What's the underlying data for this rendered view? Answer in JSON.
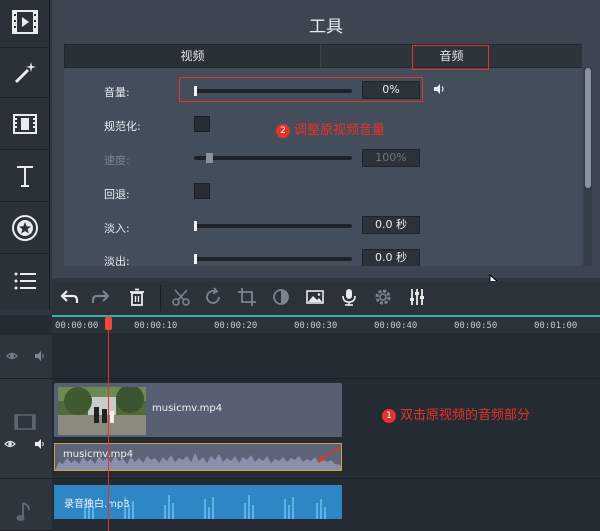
{
  "panel": {
    "title": "工具",
    "tabs": [
      {
        "label": "视频"
      },
      {
        "label": "音频"
      }
    ]
  },
  "properties": {
    "volume": {
      "label": "音量:",
      "value": "0%"
    },
    "normalize": {
      "label": "规范化:"
    },
    "speed": {
      "label": "速度:",
      "value": "100%"
    },
    "reverse": {
      "label": "回退:"
    },
    "fade_in": {
      "label": "淡入:",
      "value": "0.0 秒"
    },
    "fade_out": {
      "label": "淡出:",
      "value": "0.0 秒"
    }
  },
  "annotations": {
    "step1": {
      "number": "1",
      "text": "双击原视频的音频部分"
    },
    "step2": {
      "number": "2",
      "text": "调整原视频音量"
    }
  },
  "timeline": {
    "ticks": [
      "00:00:00",
      "00:00:10",
      "00:00:20",
      "00:00:30",
      "00:00:40",
      "00:00:50",
      "00:01:00"
    ],
    "video_clip": {
      "name": "musicmv.mp4"
    },
    "audio_clip": {
      "name": "musicmv.mp4"
    },
    "music_clip": {
      "name": "录音独白.mp3"
    }
  },
  "colors": {
    "accent": "#39b1a6",
    "annotation": "#e5322b",
    "music_clip": "#2f86c4"
  },
  "icons": {
    "sidebar": [
      "film-icon",
      "magic-wand-icon",
      "clip-transition-icon",
      "text-icon",
      "sticker-star-icon",
      "list-icon"
    ],
    "toolbar": [
      "undo-icon",
      "redo-icon",
      "delete-icon",
      "cut-icon",
      "rotate-icon",
      "crop-icon",
      "color-adjust-icon",
      "image-icon",
      "microphone-icon",
      "settings-icon",
      "equalizer-icon"
    ]
  }
}
